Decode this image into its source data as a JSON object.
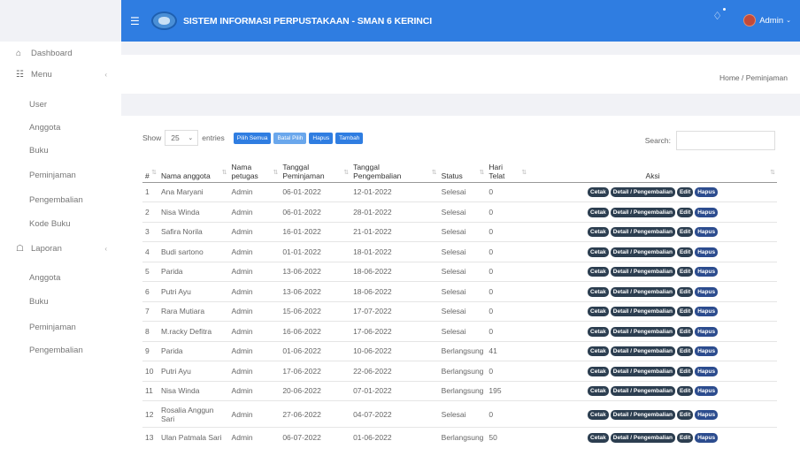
{
  "app": {
    "title": "SISTEM INFORMASI PERPUSTAKAAN - SMAN 6 KERINCI",
    "user": "Admin"
  },
  "sidebar": {
    "items": [
      {
        "label": "Dashboard",
        "icon": "home-icon"
      },
      {
        "label": "Menu",
        "icon": "doc-icon",
        "chevron": true
      },
      {
        "label": "User"
      },
      {
        "label": "Anggota"
      },
      {
        "label": "Buku"
      },
      {
        "label": "Peminjaman"
      },
      {
        "label": "Pengembalian"
      },
      {
        "label": "Kode Buku"
      },
      {
        "label": "Laporan",
        "icon": "bank-icon",
        "chevron": true
      },
      {
        "label": "Anggota"
      },
      {
        "label": "Buku"
      },
      {
        "label": "Peminjaman"
      },
      {
        "label": "Pengembalian"
      }
    ]
  },
  "breadcrumb": "Home / Peminjaman",
  "controls": {
    "show": "Show",
    "entries_value": "25",
    "entries": "entries",
    "search": "Search:"
  },
  "buttons": {
    "pilih_semua": "Pilih Semua",
    "batal_pilih": "Batal Pilih",
    "hapus": "Hapus",
    "tambah": "Tambah"
  },
  "table": {
    "headers": [
      "#",
      "Nama anggota",
      "Nama petugas",
      "Tanggal Peminjaman",
      "Tanggal Pengembalian",
      "Status",
      "Hari Telat",
      "Aksi"
    ],
    "actions": {
      "cetak": "Cetak",
      "detail": "Detail / Pengembalian",
      "edit": "Edit",
      "hapus": "Hapus"
    },
    "rows": [
      [
        "1",
        "Ana Maryani",
        "Admin",
        "06-01-2022",
        "12-01-2022",
        "Selesai",
        "0"
      ],
      [
        "2",
        "Nisa Winda",
        "Admin",
        "06-01-2022",
        "28-01-2022",
        "Selesai",
        "0"
      ],
      [
        "3",
        "Safira Norila",
        "Admin",
        "16-01-2022",
        "21-01-2022",
        "Selesai",
        "0"
      ],
      [
        "4",
        "Budi sartono",
        "Admin",
        "01-01-2022",
        "18-01-2022",
        "Selesai",
        "0"
      ],
      [
        "5",
        "Parida",
        "Admin",
        "13-06-2022",
        "18-06-2022",
        "Selesai",
        "0"
      ],
      [
        "6",
        "Putri Ayu",
        "Admin",
        "13-06-2022",
        "18-06-2022",
        "Selesai",
        "0"
      ],
      [
        "7",
        "Rara Mutiara",
        "Admin",
        "15-06-2022",
        "17-07-2022",
        "Selesai",
        "0"
      ],
      [
        "8",
        "M.racky Defitra",
        "Admin",
        "16-06-2022",
        "17-06-2022",
        "Selesai",
        "0"
      ],
      [
        "9",
        "Parida",
        "Admin",
        "01-06-2022",
        "10-06-2022",
        "Berlangsung",
        "41"
      ],
      [
        "10",
        "Putri Ayu",
        "Admin",
        "17-06-2022",
        "22-06-2022",
        "Berlangsung",
        "0"
      ],
      [
        "11",
        "Nisa Winda",
        "Admin",
        "20-06-2022",
        "07-01-2022",
        "Berlangsung",
        "195"
      ],
      [
        "12",
        "Rosalia Anggun Sari",
        "Admin",
        "27-06-2022",
        "04-07-2022",
        "Selesai",
        "0"
      ],
      [
        "13",
        "Ulan Patmala Sari",
        "Admin",
        "06-07-2022",
        "01-06-2022",
        "Berlangsung",
        "50"
      ]
    ]
  }
}
